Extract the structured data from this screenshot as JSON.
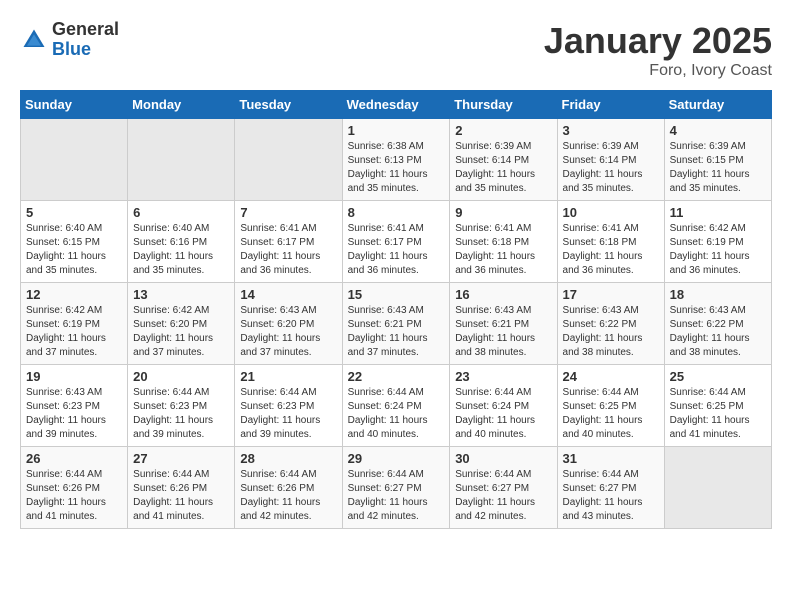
{
  "header": {
    "logo_general": "General",
    "logo_blue": "Blue",
    "month_title": "January 2025",
    "subtitle": "Foro, Ivory Coast"
  },
  "weekdays": [
    "Sunday",
    "Monday",
    "Tuesday",
    "Wednesday",
    "Thursday",
    "Friday",
    "Saturday"
  ],
  "weeks": [
    [
      {
        "day": "",
        "info": ""
      },
      {
        "day": "",
        "info": ""
      },
      {
        "day": "",
        "info": ""
      },
      {
        "day": "1",
        "info": "Sunrise: 6:38 AM\nSunset: 6:13 PM\nDaylight: 11 hours\nand 35 minutes."
      },
      {
        "day": "2",
        "info": "Sunrise: 6:39 AM\nSunset: 6:14 PM\nDaylight: 11 hours\nand 35 minutes."
      },
      {
        "day": "3",
        "info": "Sunrise: 6:39 AM\nSunset: 6:14 PM\nDaylight: 11 hours\nand 35 minutes."
      },
      {
        "day": "4",
        "info": "Sunrise: 6:39 AM\nSunset: 6:15 PM\nDaylight: 11 hours\nand 35 minutes."
      }
    ],
    [
      {
        "day": "5",
        "info": "Sunrise: 6:40 AM\nSunset: 6:15 PM\nDaylight: 11 hours\nand 35 minutes."
      },
      {
        "day": "6",
        "info": "Sunrise: 6:40 AM\nSunset: 6:16 PM\nDaylight: 11 hours\nand 35 minutes."
      },
      {
        "day": "7",
        "info": "Sunrise: 6:41 AM\nSunset: 6:17 PM\nDaylight: 11 hours\nand 36 minutes."
      },
      {
        "day": "8",
        "info": "Sunrise: 6:41 AM\nSunset: 6:17 PM\nDaylight: 11 hours\nand 36 minutes."
      },
      {
        "day": "9",
        "info": "Sunrise: 6:41 AM\nSunset: 6:18 PM\nDaylight: 11 hours\nand 36 minutes."
      },
      {
        "day": "10",
        "info": "Sunrise: 6:41 AM\nSunset: 6:18 PM\nDaylight: 11 hours\nand 36 minutes."
      },
      {
        "day": "11",
        "info": "Sunrise: 6:42 AM\nSunset: 6:19 PM\nDaylight: 11 hours\nand 36 minutes."
      }
    ],
    [
      {
        "day": "12",
        "info": "Sunrise: 6:42 AM\nSunset: 6:19 PM\nDaylight: 11 hours\nand 37 minutes."
      },
      {
        "day": "13",
        "info": "Sunrise: 6:42 AM\nSunset: 6:20 PM\nDaylight: 11 hours\nand 37 minutes."
      },
      {
        "day": "14",
        "info": "Sunrise: 6:43 AM\nSunset: 6:20 PM\nDaylight: 11 hours\nand 37 minutes."
      },
      {
        "day": "15",
        "info": "Sunrise: 6:43 AM\nSunset: 6:21 PM\nDaylight: 11 hours\nand 37 minutes."
      },
      {
        "day": "16",
        "info": "Sunrise: 6:43 AM\nSunset: 6:21 PM\nDaylight: 11 hours\nand 38 minutes."
      },
      {
        "day": "17",
        "info": "Sunrise: 6:43 AM\nSunset: 6:22 PM\nDaylight: 11 hours\nand 38 minutes."
      },
      {
        "day": "18",
        "info": "Sunrise: 6:43 AM\nSunset: 6:22 PM\nDaylight: 11 hours\nand 38 minutes."
      }
    ],
    [
      {
        "day": "19",
        "info": "Sunrise: 6:43 AM\nSunset: 6:23 PM\nDaylight: 11 hours\nand 39 minutes."
      },
      {
        "day": "20",
        "info": "Sunrise: 6:44 AM\nSunset: 6:23 PM\nDaylight: 11 hours\nand 39 minutes."
      },
      {
        "day": "21",
        "info": "Sunrise: 6:44 AM\nSunset: 6:23 PM\nDaylight: 11 hours\nand 39 minutes."
      },
      {
        "day": "22",
        "info": "Sunrise: 6:44 AM\nSunset: 6:24 PM\nDaylight: 11 hours\nand 40 minutes."
      },
      {
        "day": "23",
        "info": "Sunrise: 6:44 AM\nSunset: 6:24 PM\nDaylight: 11 hours\nand 40 minutes."
      },
      {
        "day": "24",
        "info": "Sunrise: 6:44 AM\nSunset: 6:25 PM\nDaylight: 11 hours\nand 40 minutes."
      },
      {
        "day": "25",
        "info": "Sunrise: 6:44 AM\nSunset: 6:25 PM\nDaylight: 11 hours\nand 41 minutes."
      }
    ],
    [
      {
        "day": "26",
        "info": "Sunrise: 6:44 AM\nSunset: 6:26 PM\nDaylight: 11 hours\nand 41 minutes."
      },
      {
        "day": "27",
        "info": "Sunrise: 6:44 AM\nSunset: 6:26 PM\nDaylight: 11 hours\nand 41 minutes."
      },
      {
        "day": "28",
        "info": "Sunrise: 6:44 AM\nSunset: 6:26 PM\nDaylight: 11 hours\nand 42 minutes."
      },
      {
        "day": "29",
        "info": "Sunrise: 6:44 AM\nSunset: 6:27 PM\nDaylight: 11 hours\nand 42 minutes."
      },
      {
        "day": "30",
        "info": "Sunrise: 6:44 AM\nSunset: 6:27 PM\nDaylight: 11 hours\nand 42 minutes."
      },
      {
        "day": "31",
        "info": "Sunrise: 6:44 AM\nSunset: 6:27 PM\nDaylight: 11 hours\nand 43 minutes."
      },
      {
        "day": "",
        "info": ""
      }
    ]
  ]
}
